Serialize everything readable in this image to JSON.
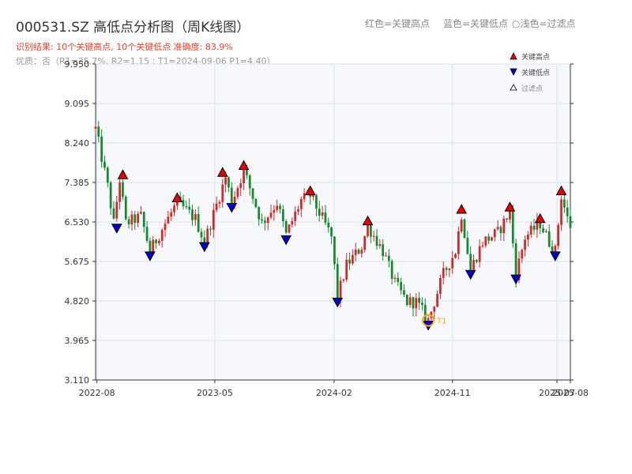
{
  "header": {
    "title": "000531.SZ 高低点分析图（周K线图）",
    "result": "识别结果: 10个关键高点, 10个关键低点   准确度: 83.9%",
    "quality": "优质：否（R1=35.7%, R2=1.15 ; T1=2024-09-06 P1=4.40）"
  },
  "top_legend": {
    "red": "红色=关键高点",
    "blue": "蓝色=关键低点",
    "light": "○浅色=过滤点"
  },
  "legend": {
    "high": "关键高点",
    "low": "关键低点",
    "filtered": "过滤点"
  },
  "colors": {
    "up": "#d62728",
    "down": "#138a2e",
    "high_marker": "#e60000",
    "low_marker": "#0000cc",
    "t1_marker": "#f5a623",
    "plot_bg": "#f6f8fb",
    "grid": "#dde3ea"
  },
  "chart_data": {
    "type": "candlestick",
    "xlabel": "",
    "ylabel": "",
    "ylim": [
      3.11,
      9.95
    ],
    "yticks": [
      "3.110",
      "3.965",
      "4.820",
      "5.675",
      "6.530",
      "7.385",
      "8.240",
      "9.095",
      "9.950"
    ],
    "xticks": [
      "2022-08",
      "2023-05",
      "2024-02",
      "2024-11",
      "2025-07",
      "2025-08"
    ],
    "x_start": "2022-07-29",
    "x_end": "2025-08-01",
    "grid": true,
    "legend_position": "top-right",
    "price_path": [
      [
        "2022-07-29",
        8.55
      ],
      [
        "2022-08-26",
        7.3
      ],
      [
        "2022-09-09",
        6.5
      ],
      [
        "2022-09-23",
        7.45
      ],
      [
        "2022-10-07",
        6.5
      ],
      [
        "2022-11-11",
        6.65
      ],
      [
        "2022-12-02",
        5.9
      ],
      [
        "2023-01-06",
        6.5
      ],
      [
        "2023-02-03",
        6.95
      ],
      [
        "2023-03-17",
        6.6
      ],
      [
        "2023-04-07",
        6.1
      ],
      [
        "2023-05-05",
        6.9
      ],
      [
        "2023-05-26",
        7.5
      ],
      [
        "2023-06-09",
        6.95
      ],
      [
        "2023-07-07",
        7.65
      ],
      [
        "2023-08-18",
        6.5
      ],
      [
        "2023-09-22",
        6.95
      ],
      [
        "2023-10-13",
        6.25
      ],
      [
        "2023-11-17",
        7.0
      ],
      [
        "2023-12-08",
        7.1
      ],
      [
        "2024-01-05",
        6.6
      ],
      [
        "2024-01-26",
        6.2
      ],
      [
        "2024-02-09",
        4.9
      ],
      [
        "2024-03-01",
        5.6
      ],
      [
        "2024-04-05",
        6.0
      ],
      [
        "2024-04-19",
        6.45
      ],
      [
        "2024-05-24",
        5.9
      ],
      [
        "2024-06-21",
        5.2
      ],
      [
        "2024-07-19",
        4.8
      ],
      [
        "2024-08-09",
        4.8
      ],
      [
        "2024-09-06",
        4.4
      ],
      [
        "2024-09-27",
        5.0
      ],
      [
        "2024-10-11",
        5.4
      ],
      [
        "2024-11-08",
        5.9
      ],
      [
        "2024-11-22",
        6.7
      ],
      [
        "2024-12-13",
        5.5
      ],
      [
        "2025-01-10",
        6.1
      ],
      [
        "2025-02-14",
        6.3
      ],
      [
        "2025-03-14",
        6.75
      ],
      [
        "2025-03-28",
        5.4
      ],
      [
        "2025-04-18",
        6.2
      ],
      [
        "2025-05-23",
        6.5
      ],
      [
        "2025-06-13",
        6.1
      ],
      [
        "2025-06-27",
        5.9
      ],
      [
        "2025-07-11",
        7.1
      ],
      [
        "2025-07-25",
        6.6
      ],
      [
        "2025-08-01",
        6.45
      ]
    ],
    "key_highs": [
      {
        "date": "2022-09-30",
        "price": 7.45
      },
      {
        "date": "2023-02-03",
        "price": 6.95
      },
      {
        "date": "2023-05-19",
        "price": 7.5
      },
      {
        "date": "2023-07-07",
        "price": 7.65
      },
      {
        "date": "2023-12-08",
        "price": 7.1
      },
      {
        "date": "2024-04-19",
        "price": 6.45
      },
      {
        "date": "2024-11-22",
        "price": 6.7
      },
      {
        "date": "2025-03-14",
        "price": 6.75
      },
      {
        "date": "2025-05-23",
        "price": 6.5
      },
      {
        "date": "2025-07-11",
        "price": 7.1
      }
    ],
    "key_lows": [
      {
        "date": "2022-09-16",
        "price": 6.5
      },
      {
        "date": "2022-12-02",
        "price": 5.9
      },
      {
        "date": "2023-04-07",
        "price": 6.1
      },
      {
        "date": "2023-06-09",
        "price": 6.95
      },
      {
        "date": "2023-10-13",
        "price": 6.25
      },
      {
        "date": "2024-02-09",
        "price": 4.9
      },
      {
        "date": "2024-09-06",
        "price": 4.4
      },
      {
        "date": "2024-12-13",
        "price": 5.5
      },
      {
        "date": "2025-03-28",
        "price": 5.4
      },
      {
        "date": "2025-06-27",
        "price": 5.9
      }
    ],
    "annotations": [
      {
        "label": "T1",
        "date": "2024-09-06",
        "price": 4.4
      }
    ]
  }
}
